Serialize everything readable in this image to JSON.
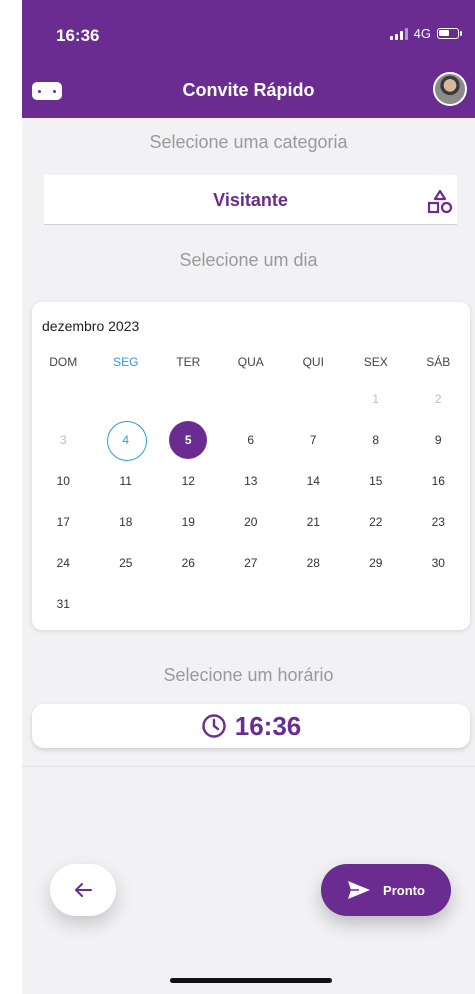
{
  "status_bar": {
    "time": "16:36",
    "network": "4G"
  },
  "header": {
    "title": "Convite Rápido"
  },
  "category": {
    "prompt": "Selecione uma categoria",
    "value": "Visitante"
  },
  "day": {
    "prompt": "Selecione um dia"
  },
  "calendar": {
    "month_label": "dezembro 2023",
    "weekdays": [
      "DOM",
      "SEG",
      "TER",
      "QUA",
      "QUI",
      "SEX",
      "SÁB"
    ],
    "weeks": [
      [
        "",
        "",
        "",
        "",
        "",
        "1",
        "2"
      ],
      [
        "3",
        "4",
        "5",
        "6",
        "7",
        "8",
        "9"
      ],
      [
        "10",
        "11",
        "12",
        "13",
        "14",
        "15",
        "16"
      ],
      [
        "17",
        "18",
        "19",
        "20",
        "21",
        "22",
        "23"
      ],
      [
        "24",
        "25",
        "26",
        "27",
        "28",
        "29",
        "30"
      ],
      [
        "31",
        "",
        "",
        "",
        "",
        "",
        ""
      ]
    ],
    "today": "4",
    "selected": "5"
  },
  "time": {
    "prompt": "Selecione um horário",
    "value": "16:36"
  },
  "actions": {
    "done_label": "Pronto"
  },
  "icons": {
    "menu": "menu-icon",
    "avatar": "avatar",
    "category": "shapes-icon",
    "clock": "clock-icon",
    "back": "arrow-left-icon",
    "send": "send-icon"
  },
  "colors": {
    "primary": "#6a2c91",
    "today": "#2d9cdb",
    "background": "#f2f2f4"
  }
}
